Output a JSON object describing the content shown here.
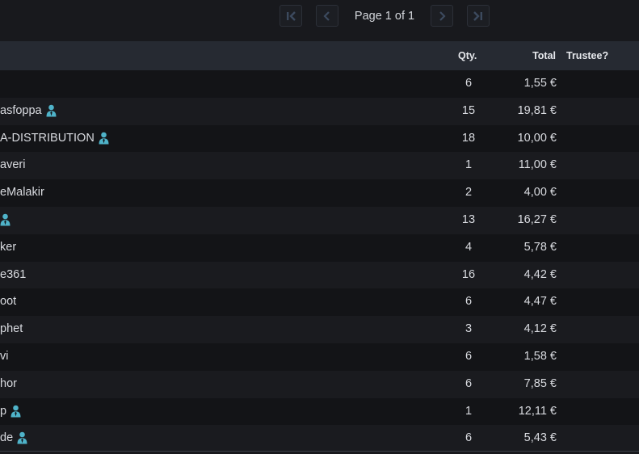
{
  "pagination": {
    "label": "Page 1 of 1",
    "first_icon": "first-page-icon",
    "prev_icon": "chevron-left-icon",
    "next_icon": "chevron-right-icon",
    "last_icon": "last-page-icon"
  },
  "table": {
    "columns": {
      "qty": "Qty.",
      "total": "Total",
      "trustee": "Trustee?"
    },
    "rows": [
      {
        "name": "",
        "trustee": false,
        "qty": "6",
        "total": "1,55 €"
      },
      {
        "name": "asfoppa",
        "trustee": true,
        "qty": "15",
        "total": "19,81 €"
      },
      {
        "name": "A-DISTRIBUTION",
        "trustee": true,
        "qty": "18",
        "total": "10,00 €"
      },
      {
        "name": "averi",
        "trustee": false,
        "qty": "1",
        "total": "11,00 €"
      },
      {
        "name": "eMalakir",
        "trustee": false,
        "qty": "2",
        "total": "4,00 €"
      },
      {
        "name": "",
        "trustee": true,
        "qty": "13",
        "total": "16,27 €"
      },
      {
        "name": "ker",
        "trustee": false,
        "qty": "4",
        "total": "5,78 €"
      },
      {
        "name": "e361",
        "trustee": false,
        "qty": "16",
        "total": "4,42 €"
      },
      {
        "name": "oot",
        "trustee": false,
        "qty": "6",
        "total": "4,47 €"
      },
      {
        "name": "phet",
        "trustee": false,
        "qty": "3",
        "total": "4,12 €"
      },
      {
        "name": "vi",
        "trustee": false,
        "qty": "6",
        "total": "1,58 €"
      },
      {
        "name": "hor",
        "trustee": false,
        "qty": "6",
        "total": "7,85 €"
      },
      {
        "name": "p",
        "trustee": true,
        "qty": "1",
        "total": "12,11 €"
      },
      {
        "name": "de",
        "trustee": true,
        "qty": "6",
        "total": "5,43 €"
      }
    ]
  },
  "colors": {
    "background": "#18191d",
    "header": "#262a32",
    "trustee_icon": "#4fb3c9"
  }
}
